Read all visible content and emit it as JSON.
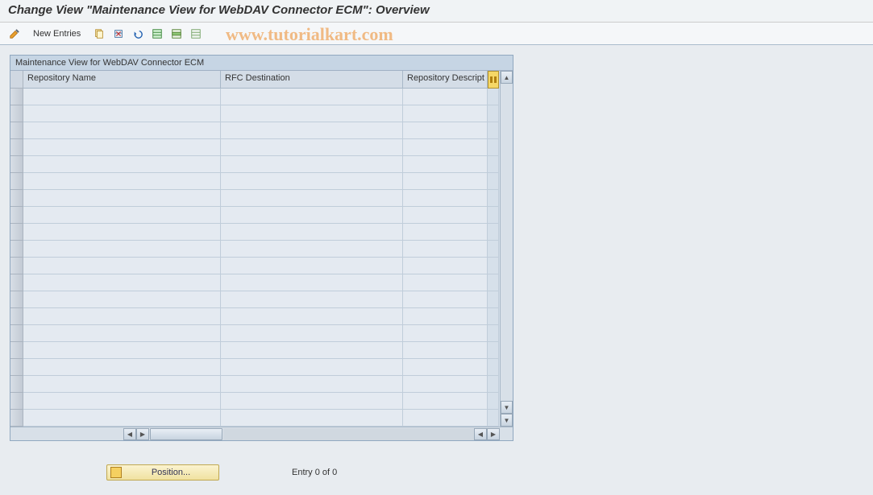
{
  "title": "Change View \"Maintenance View for WebDAV Connector ECM\": Overview",
  "toolbar": {
    "new_entries_label": "New Entries",
    "icons": {
      "edit": "edit-pencil-icon",
      "copy": "copy-icon",
      "delete": "delete-icon",
      "undo": "undo-icon",
      "select_all": "select-all-icon",
      "select_block": "select-block-icon",
      "deselect_all": "deselect-all-icon"
    }
  },
  "watermark": "www.tutorialkart.com",
  "panel": {
    "header": "Maintenance View for WebDAV Connector ECM",
    "columns": [
      "Repository Name",
      "RFC Destination",
      "Repository Descript"
    ],
    "visible_row_count": 20
  },
  "footer": {
    "position_label": "Position...",
    "entry_text": "Entry 0 of 0"
  }
}
